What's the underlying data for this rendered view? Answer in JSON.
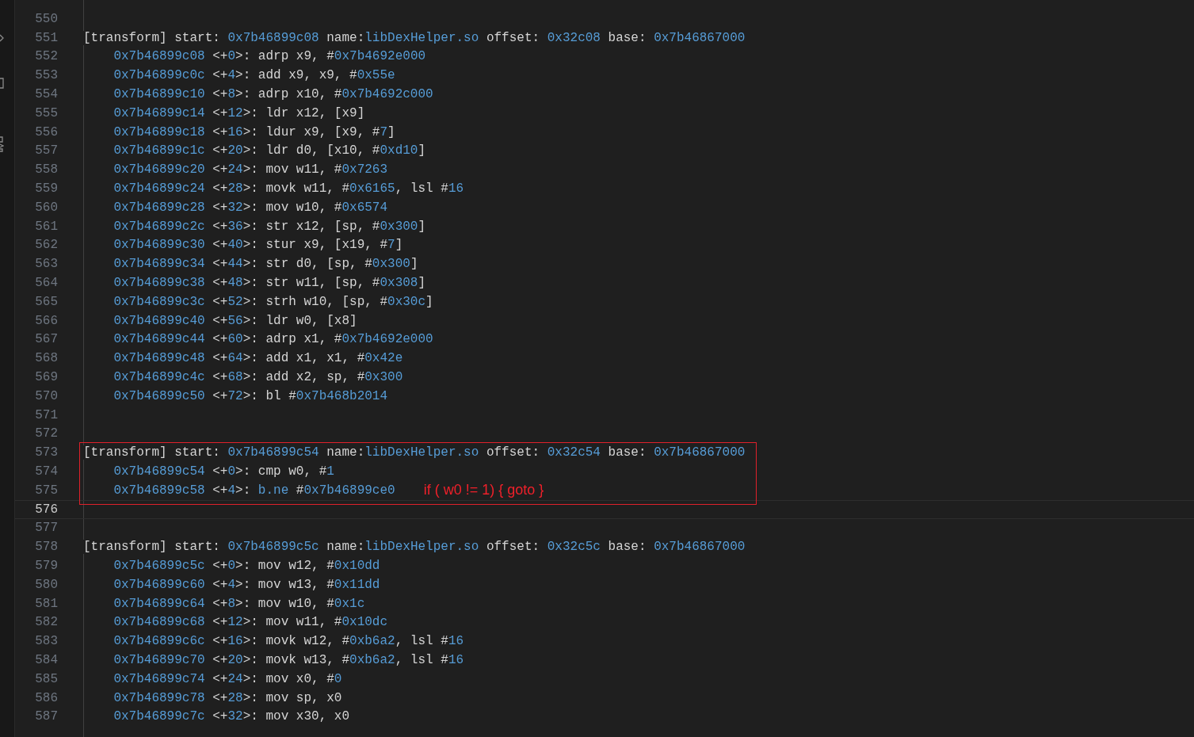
{
  "editor": {
    "lines": [
      {
        "number": "550",
        "kind": "blank",
        "current": false,
        "annotated": false
      },
      {
        "number": "551",
        "kind": "header",
        "current": false,
        "annotated": false,
        "tokens": [
          {
            "text": "[transform] start: ",
            "kind": "plain"
          },
          {
            "text": "0x7b46899c08",
            "kind": "hex"
          },
          {
            "text": " name:",
            "kind": "plain"
          },
          {
            "text": "libDexHelper.so",
            "kind": "hex"
          },
          {
            "text": " offset: ",
            "kind": "plain"
          },
          {
            "text": "0x32c08",
            "kind": "hex"
          },
          {
            "text": " base: ",
            "kind": "plain"
          },
          {
            "text": "0x7b46867000",
            "kind": "hex"
          }
        ]
      },
      {
        "number": "552",
        "kind": "instruction",
        "current": false,
        "annotated": false,
        "tokens": [
          {
            "text": "0x7b46899c08",
            "kind": "hex"
          },
          {
            "text": " <+",
            "kind": "plain"
          },
          {
            "text": "0",
            "kind": "hex"
          },
          {
            "text": ">: adrp x9, #",
            "kind": "plain"
          },
          {
            "text": "0x7b4692e000",
            "kind": "hex"
          }
        ]
      },
      {
        "number": "553",
        "kind": "instruction",
        "current": false,
        "annotated": false,
        "tokens": [
          {
            "text": "0x7b46899c0c",
            "kind": "hex"
          },
          {
            "text": " <+",
            "kind": "plain"
          },
          {
            "text": "4",
            "kind": "hex"
          },
          {
            "text": ">: add x9, x9, #",
            "kind": "plain"
          },
          {
            "text": "0x55e",
            "kind": "hex"
          }
        ]
      },
      {
        "number": "554",
        "kind": "instruction",
        "current": false,
        "annotated": false,
        "tokens": [
          {
            "text": "0x7b46899c10",
            "kind": "hex"
          },
          {
            "text": " <+",
            "kind": "plain"
          },
          {
            "text": "8",
            "kind": "hex"
          },
          {
            "text": ">: adrp x10, #",
            "kind": "plain"
          },
          {
            "text": "0x7b4692c000",
            "kind": "hex"
          }
        ]
      },
      {
        "number": "555",
        "kind": "instruction",
        "current": false,
        "annotated": false,
        "tokens": [
          {
            "text": "0x7b46899c14",
            "kind": "hex"
          },
          {
            "text": " <+",
            "kind": "plain"
          },
          {
            "text": "12",
            "kind": "hex"
          },
          {
            "text": ">: ldr x12, [x9]",
            "kind": "plain"
          }
        ]
      },
      {
        "number": "556",
        "kind": "instruction",
        "current": false,
        "annotated": false,
        "tokens": [
          {
            "text": "0x7b46899c18",
            "kind": "hex"
          },
          {
            "text": " <+",
            "kind": "plain"
          },
          {
            "text": "16",
            "kind": "hex"
          },
          {
            "text": ">: ldur x9, [x9, #",
            "kind": "plain"
          },
          {
            "text": "7",
            "kind": "hex"
          },
          {
            "text": "]",
            "kind": "plain"
          }
        ]
      },
      {
        "number": "557",
        "kind": "instruction",
        "current": false,
        "annotated": false,
        "tokens": [
          {
            "text": "0x7b46899c1c",
            "kind": "hex"
          },
          {
            "text": " <+",
            "kind": "plain"
          },
          {
            "text": "20",
            "kind": "hex"
          },
          {
            "text": ">: ldr d0, [x10, #",
            "kind": "plain"
          },
          {
            "text": "0xd10",
            "kind": "hex"
          },
          {
            "text": "]",
            "kind": "plain"
          }
        ]
      },
      {
        "number": "558",
        "kind": "instruction",
        "current": false,
        "annotated": false,
        "tokens": [
          {
            "text": "0x7b46899c20",
            "kind": "hex"
          },
          {
            "text": " <+",
            "kind": "plain"
          },
          {
            "text": "24",
            "kind": "hex"
          },
          {
            "text": ">: mov w11, #",
            "kind": "plain"
          },
          {
            "text": "0x7263",
            "kind": "hex"
          }
        ]
      },
      {
        "number": "559",
        "kind": "instruction",
        "current": false,
        "annotated": false,
        "tokens": [
          {
            "text": "0x7b46899c24",
            "kind": "hex"
          },
          {
            "text": " <+",
            "kind": "plain"
          },
          {
            "text": "28",
            "kind": "hex"
          },
          {
            "text": ">: movk w11, #",
            "kind": "plain"
          },
          {
            "text": "0x6165",
            "kind": "hex"
          },
          {
            "text": ", lsl #",
            "kind": "plain"
          },
          {
            "text": "16",
            "kind": "hex"
          }
        ]
      },
      {
        "number": "560",
        "kind": "instruction",
        "current": false,
        "annotated": false,
        "tokens": [
          {
            "text": "0x7b46899c28",
            "kind": "hex"
          },
          {
            "text": " <+",
            "kind": "plain"
          },
          {
            "text": "32",
            "kind": "hex"
          },
          {
            "text": ">: mov w10, #",
            "kind": "plain"
          },
          {
            "text": "0x6574",
            "kind": "hex"
          }
        ]
      },
      {
        "number": "561",
        "kind": "instruction",
        "current": false,
        "annotated": false,
        "tokens": [
          {
            "text": "0x7b46899c2c",
            "kind": "hex"
          },
          {
            "text": " <+",
            "kind": "plain"
          },
          {
            "text": "36",
            "kind": "hex"
          },
          {
            "text": ">: str x12, [sp, #",
            "kind": "plain"
          },
          {
            "text": "0x300",
            "kind": "hex"
          },
          {
            "text": "]",
            "kind": "plain"
          }
        ]
      },
      {
        "number": "562",
        "kind": "instruction",
        "current": false,
        "annotated": false,
        "tokens": [
          {
            "text": "0x7b46899c30",
            "kind": "hex"
          },
          {
            "text": " <+",
            "kind": "plain"
          },
          {
            "text": "40",
            "kind": "hex"
          },
          {
            "text": ">: stur x9, [x19, #",
            "kind": "plain"
          },
          {
            "text": "7",
            "kind": "hex"
          },
          {
            "text": "]",
            "kind": "plain"
          }
        ]
      },
      {
        "number": "563",
        "kind": "instruction",
        "current": false,
        "annotated": false,
        "tokens": [
          {
            "text": "0x7b46899c34",
            "kind": "hex"
          },
          {
            "text": " <+",
            "kind": "plain"
          },
          {
            "text": "44",
            "kind": "hex"
          },
          {
            "text": ">: str d0, [sp, #",
            "kind": "plain"
          },
          {
            "text": "0x300",
            "kind": "hex"
          },
          {
            "text": "]",
            "kind": "plain"
          }
        ]
      },
      {
        "number": "564",
        "kind": "instruction",
        "current": false,
        "annotated": false,
        "tokens": [
          {
            "text": "0x7b46899c38",
            "kind": "hex"
          },
          {
            "text": " <+",
            "kind": "plain"
          },
          {
            "text": "48",
            "kind": "hex"
          },
          {
            "text": ">: str w11, [sp, #",
            "kind": "plain"
          },
          {
            "text": "0x308",
            "kind": "hex"
          },
          {
            "text": "]",
            "kind": "plain"
          }
        ]
      },
      {
        "number": "565",
        "kind": "instruction",
        "current": false,
        "annotated": false,
        "tokens": [
          {
            "text": "0x7b46899c3c",
            "kind": "hex"
          },
          {
            "text": " <+",
            "kind": "plain"
          },
          {
            "text": "52",
            "kind": "hex"
          },
          {
            "text": ">: strh w10, [sp, #",
            "kind": "plain"
          },
          {
            "text": "0x30c",
            "kind": "hex"
          },
          {
            "text": "]",
            "kind": "plain"
          }
        ]
      },
      {
        "number": "566",
        "kind": "instruction",
        "current": false,
        "annotated": false,
        "tokens": [
          {
            "text": "0x7b46899c40",
            "kind": "hex"
          },
          {
            "text": " <+",
            "kind": "plain"
          },
          {
            "text": "56",
            "kind": "hex"
          },
          {
            "text": ">: ldr w0, [x8]",
            "kind": "plain"
          }
        ]
      },
      {
        "number": "567",
        "kind": "instruction",
        "current": false,
        "annotated": false,
        "tokens": [
          {
            "text": "0x7b46899c44",
            "kind": "hex"
          },
          {
            "text": " <+",
            "kind": "plain"
          },
          {
            "text": "60",
            "kind": "hex"
          },
          {
            "text": ">: adrp x1, #",
            "kind": "plain"
          },
          {
            "text": "0x7b4692e000",
            "kind": "hex"
          }
        ]
      },
      {
        "number": "568",
        "kind": "instruction",
        "current": false,
        "annotated": false,
        "tokens": [
          {
            "text": "0x7b46899c48",
            "kind": "hex"
          },
          {
            "text": " <+",
            "kind": "plain"
          },
          {
            "text": "64",
            "kind": "hex"
          },
          {
            "text": ">: add x1, x1, #",
            "kind": "plain"
          },
          {
            "text": "0x42e",
            "kind": "hex"
          }
        ]
      },
      {
        "number": "569",
        "kind": "instruction",
        "current": false,
        "annotated": false,
        "tokens": [
          {
            "text": "0x7b46899c4c",
            "kind": "hex"
          },
          {
            "text": " <+",
            "kind": "plain"
          },
          {
            "text": "68",
            "kind": "hex"
          },
          {
            "text": ">: add x2, sp, #",
            "kind": "plain"
          },
          {
            "text": "0x300",
            "kind": "hex"
          }
        ]
      },
      {
        "number": "570",
        "kind": "instruction",
        "current": false,
        "annotated": false,
        "tokens": [
          {
            "text": "0x7b46899c50",
            "kind": "hex"
          },
          {
            "text": " <+",
            "kind": "plain"
          },
          {
            "text": "72",
            "kind": "hex"
          },
          {
            "text": ">: bl #",
            "kind": "plain"
          },
          {
            "text": "0x7b468b2014",
            "kind": "hex"
          }
        ]
      },
      {
        "number": "571",
        "kind": "blank",
        "current": false,
        "annotated": false
      },
      {
        "number": "572",
        "kind": "blank",
        "current": false,
        "annotated": false
      },
      {
        "number": "573",
        "kind": "header",
        "current": false,
        "annotated": true,
        "tokens": [
          {
            "text": "[transform] start: ",
            "kind": "plain"
          },
          {
            "text": "0x7b46899c54",
            "kind": "hex"
          },
          {
            "text": " name:",
            "kind": "plain"
          },
          {
            "text": "libDexHelper.so",
            "kind": "hex"
          },
          {
            "text": " offset: ",
            "kind": "plain"
          },
          {
            "text": "0x32c54",
            "kind": "hex"
          },
          {
            "text": " base: ",
            "kind": "plain"
          },
          {
            "text": "0x7b46867000",
            "kind": "hex"
          }
        ]
      },
      {
        "number": "574",
        "kind": "instruction",
        "current": false,
        "annotated": true,
        "tokens": [
          {
            "text": "0x7b46899c54",
            "kind": "hex"
          },
          {
            "text": " <+",
            "kind": "plain"
          },
          {
            "text": "0",
            "kind": "hex"
          },
          {
            "text": ">: cmp w0, #",
            "kind": "plain"
          },
          {
            "text": "1",
            "kind": "hex"
          }
        ]
      },
      {
        "number": "575",
        "kind": "instruction",
        "current": false,
        "annotated": true,
        "tokens": [
          {
            "text": "0x7b46899c58",
            "kind": "hex"
          },
          {
            "text": " <+",
            "kind": "plain"
          },
          {
            "text": "4",
            "kind": "hex"
          },
          {
            "text": ">: ",
            "kind": "plain"
          },
          {
            "text": "b.ne",
            "kind": "hex"
          },
          {
            "text": " #",
            "kind": "plain"
          },
          {
            "text": "0x7b46899ce0",
            "kind": "hex"
          }
        ],
        "note": "if ( w0 != 1) { goto }"
      },
      {
        "number": "576",
        "kind": "blank",
        "current": true,
        "annotated": false
      },
      {
        "number": "577",
        "kind": "blank",
        "current": false,
        "annotated": false
      },
      {
        "number": "578",
        "kind": "header",
        "current": false,
        "annotated": false,
        "tokens": [
          {
            "text": "[transform] start: ",
            "kind": "plain"
          },
          {
            "text": "0x7b46899c5c",
            "kind": "hex"
          },
          {
            "text": " name:",
            "kind": "plain"
          },
          {
            "text": "libDexHelper.so",
            "kind": "hex"
          },
          {
            "text": " offset: ",
            "kind": "plain"
          },
          {
            "text": "0x32c5c",
            "kind": "hex"
          },
          {
            "text": " base: ",
            "kind": "plain"
          },
          {
            "text": "0x7b46867000",
            "kind": "hex"
          }
        ]
      },
      {
        "number": "579",
        "kind": "instruction",
        "current": false,
        "annotated": false,
        "tokens": [
          {
            "text": "0x7b46899c5c",
            "kind": "hex"
          },
          {
            "text": " <+",
            "kind": "plain"
          },
          {
            "text": "0",
            "kind": "hex"
          },
          {
            "text": ">: mov w12, #",
            "kind": "plain"
          },
          {
            "text": "0x10dd",
            "kind": "hex"
          }
        ]
      },
      {
        "number": "580",
        "kind": "instruction",
        "current": false,
        "annotated": false,
        "tokens": [
          {
            "text": "0x7b46899c60",
            "kind": "hex"
          },
          {
            "text": " <+",
            "kind": "plain"
          },
          {
            "text": "4",
            "kind": "hex"
          },
          {
            "text": ">: mov w13, #",
            "kind": "plain"
          },
          {
            "text": "0x11dd",
            "kind": "hex"
          }
        ]
      },
      {
        "number": "581",
        "kind": "instruction",
        "current": false,
        "annotated": false,
        "tokens": [
          {
            "text": "0x7b46899c64",
            "kind": "hex"
          },
          {
            "text": " <+",
            "kind": "plain"
          },
          {
            "text": "8",
            "kind": "hex"
          },
          {
            "text": ">: mov w10, #",
            "kind": "plain"
          },
          {
            "text": "0x1c",
            "kind": "hex"
          }
        ]
      },
      {
        "number": "582",
        "kind": "instruction",
        "current": false,
        "annotated": false,
        "tokens": [
          {
            "text": "0x7b46899c68",
            "kind": "hex"
          },
          {
            "text": " <+",
            "kind": "plain"
          },
          {
            "text": "12",
            "kind": "hex"
          },
          {
            "text": ">: mov w11, #",
            "kind": "plain"
          },
          {
            "text": "0x10dc",
            "kind": "hex"
          }
        ]
      },
      {
        "number": "583",
        "kind": "instruction",
        "current": false,
        "annotated": false,
        "tokens": [
          {
            "text": "0x7b46899c6c",
            "kind": "hex"
          },
          {
            "text": " <+",
            "kind": "plain"
          },
          {
            "text": "16",
            "kind": "hex"
          },
          {
            "text": ">: movk w12, #",
            "kind": "plain"
          },
          {
            "text": "0xb6a2",
            "kind": "hex"
          },
          {
            "text": ", lsl #",
            "kind": "plain"
          },
          {
            "text": "16",
            "kind": "hex"
          }
        ]
      },
      {
        "number": "584",
        "kind": "instruction",
        "current": false,
        "annotated": false,
        "tokens": [
          {
            "text": "0x7b46899c70",
            "kind": "hex"
          },
          {
            "text": " <+",
            "kind": "plain"
          },
          {
            "text": "20",
            "kind": "hex"
          },
          {
            "text": ">: movk w13, #",
            "kind": "plain"
          },
          {
            "text": "0xb6a2",
            "kind": "hex"
          },
          {
            "text": ", lsl #",
            "kind": "plain"
          },
          {
            "text": "16",
            "kind": "hex"
          }
        ]
      },
      {
        "number": "585",
        "kind": "instruction",
        "current": false,
        "annotated": false,
        "tokens": [
          {
            "text": "0x7b46899c74",
            "kind": "hex"
          },
          {
            "text": " <+",
            "kind": "plain"
          },
          {
            "text": "24",
            "kind": "hex"
          },
          {
            "text": ">: mov x0, #",
            "kind": "plain"
          },
          {
            "text": "0",
            "kind": "hex"
          }
        ]
      },
      {
        "number": "586",
        "kind": "instruction",
        "current": false,
        "annotated": false,
        "tokens": [
          {
            "text": "0x7b46899c78",
            "kind": "hex"
          },
          {
            "text": " <+",
            "kind": "plain"
          },
          {
            "text": "28",
            "kind": "hex"
          },
          {
            "text": ">: mov sp, x0",
            "kind": "plain"
          }
        ]
      },
      {
        "number": "587",
        "kind": "instruction",
        "current": false,
        "annotated": false,
        "tokens": [
          {
            "text": "0x7b46899c7c",
            "kind": "hex"
          },
          {
            "text": " <+",
            "kind": "plain"
          },
          {
            "text": "32",
            "kind": "hex"
          },
          {
            "text": ">: mov x30, x0",
            "kind": "plain"
          }
        ]
      }
    ]
  }
}
